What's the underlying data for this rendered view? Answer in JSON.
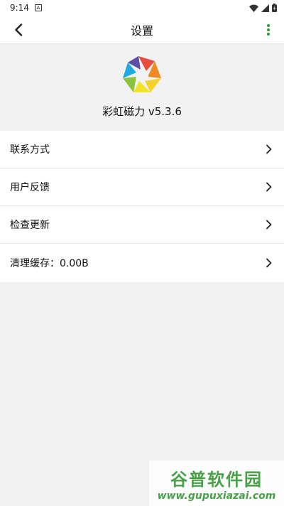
{
  "status_bar": {
    "time": "9:14",
    "notif_icon_label": "A",
    "icons": [
      "wifi-icon",
      "signal-icon",
      "battery-icon"
    ]
  },
  "app_bar": {
    "title": "设置",
    "back_icon": "back-arrow-icon",
    "more_icon": "more-vert-icon",
    "accent": "#2e9a3a"
  },
  "app_info": {
    "logo_icon": "aperture-logo-icon",
    "version_text": "彩虹磁力 v5.3.6"
  },
  "menu": {
    "items": [
      {
        "label": "联系方式"
      },
      {
        "label": "用户反馈"
      },
      {
        "label": "检查更新"
      },
      {
        "label": "清理缓存：0.00B"
      }
    ]
  },
  "watermark": {
    "line1": "谷普软件园",
    "line2": "www.gupuxiazai.com",
    "color": "#3a9a3a"
  }
}
